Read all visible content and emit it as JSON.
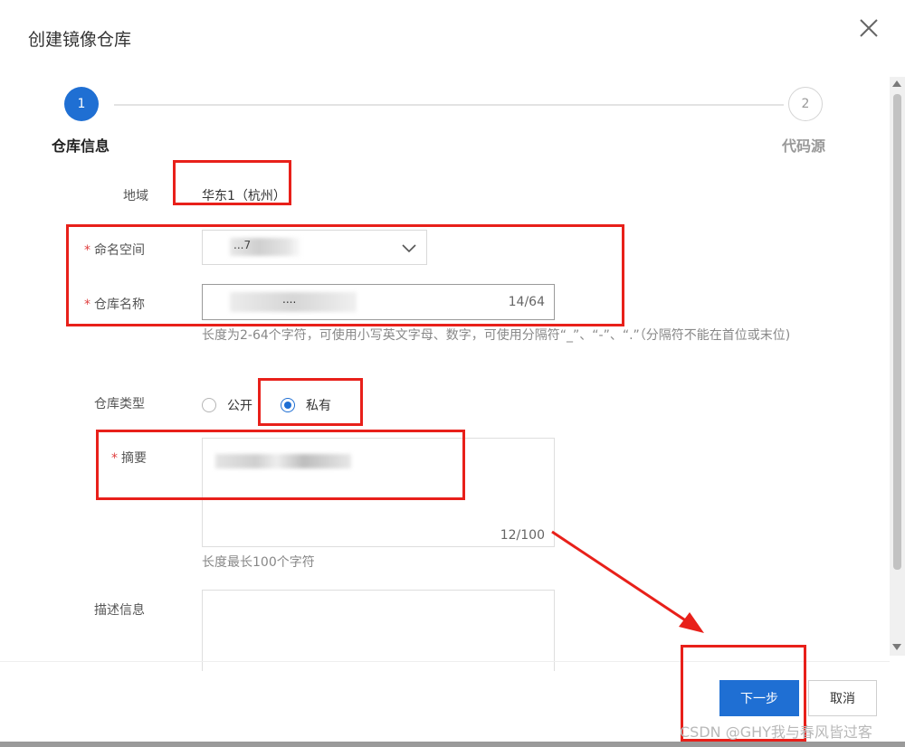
{
  "dialog": {
    "title": "创建镜像仓库"
  },
  "steps": [
    {
      "number": "1",
      "label": "仓库信息"
    },
    {
      "number": "2",
      "label": "代码源"
    }
  ],
  "form": {
    "region": {
      "label": "地域",
      "value": "华东1（杭州）"
    },
    "namespace": {
      "required_mark": "*",
      "label": "命名空间",
      "value": "...7"
    },
    "repo_name": {
      "required_mark": "*",
      "label": "仓库名称",
      "value": "....",
      "counter": "14/64",
      "hint": "长度为2-64个字符，可使用小写英文字母、数字，可使用分隔符“_”、“-”、“.”（分隔符不能在首位或末位)"
    },
    "repo_type": {
      "label": "仓库类型",
      "options": [
        "公开",
        "私有"
      ],
      "selected": "私有"
    },
    "summary": {
      "required_mark": "*",
      "label": "摘要",
      "counter": "12/100",
      "hint": "长度最长100个字符"
    },
    "description": {
      "label": "描述信息"
    }
  },
  "buttons": {
    "next": "下一步",
    "cancel": "取消"
  },
  "watermark": "CSDN @GHY我与春风皆过客",
  "colors": {
    "primary": "#1f6fd3",
    "annotation_red": "#e8201a",
    "required": "#e04040"
  }
}
